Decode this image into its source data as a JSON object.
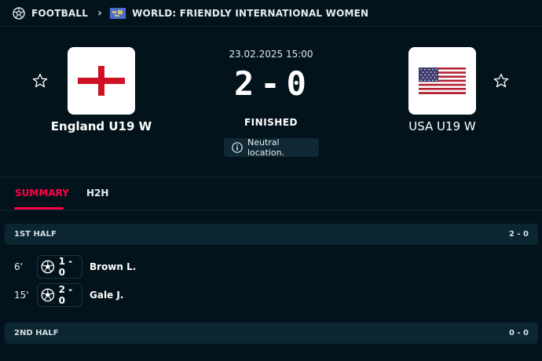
{
  "breadcrumb": {
    "sport": "FOOTBALL",
    "competition": "WORLD: FRIENDLY INTERNATIONAL WOMEN"
  },
  "match": {
    "datetime": "23.02.2025 15:00",
    "score_home": "2",
    "score_sep": "-",
    "score_away": "0",
    "status": "FINISHED",
    "neutral_note": "Neutral location.",
    "home": {
      "name": "England U19 W",
      "flag": "england-flag"
    },
    "away": {
      "name": "USA U19 W",
      "flag": "usa-flag"
    }
  },
  "tabs": [
    {
      "label": "SUMMARY",
      "active": true
    },
    {
      "label": "H2H",
      "active": false
    }
  ],
  "halves": [
    {
      "label": "1ST HALF",
      "score": "2 - 0",
      "events": [
        {
          "minute": "6'",
          "score": "1 - 0",
          "player": "Brown L.",
          "icon": "goal-ball-icon"
        },
        {
          "minute": "15'",
          "score": "2 - 0",
          "player": "Gale J.",
          "icon": "goal-ball-icon"
        }
      ]
    },
    {
      "label": "2ND HALF",
      "score": "0 - 0",
      "events": []
    }
  ],
  "colors": {
    "background": "#03131c",
    "accent": "#ff0046",
    "section_bg": "#0b2531"
  }
}
